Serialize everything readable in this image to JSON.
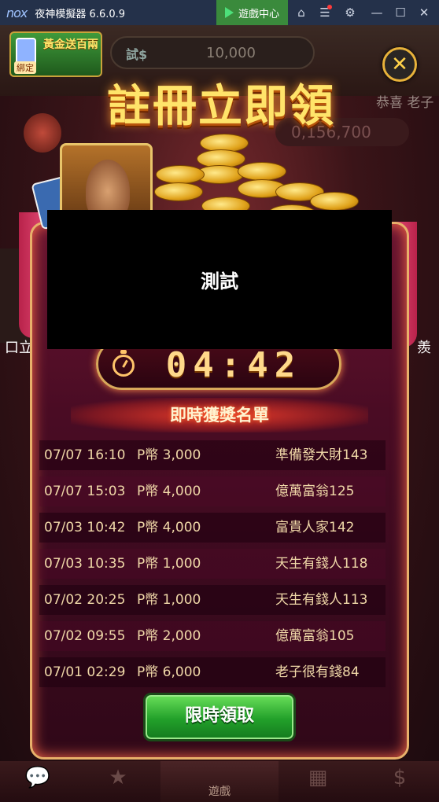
{
  "window": {
    "logo": "nox",
    "title": "夜神模擬器 6.6.0.9",
    "game_center": "遊戲中心",
    "icons": [
      "home-icon",
      "menu-icon",
      "settings-icon",
      "minimize-icon",
      "maximize-icon",
      "close-icon"
    ]
  },
  "background": {
    "bind_badge_label": "綁定",
    "bind_badge_text": "黃金送百兩",
    "trial_label": "試$",
    "trial_value": "10,000",
    "congrats_text": "恭喜 老子",
    "jackpot_value": "0,156,700",
    "side_left_text": "口立",
    "side_right_text": "羨"
  },
  "popup": {
    "banner_title": "註冊立即領",
    "timer": "04:42",
    "list_title": "即時獲獎名單",
    "winners": [
      {
        "time": "07/07 16:10",
        "prize": "P幣 3,000",
        "name": "準備發大財143"
      },
      {
        "time": "07/07 15:03",
        "prize": "P幣 4,000",
        "name": "億萬富翁125"
      },
      {
        "time": "07/03 10:42",
        "prize": "P幣 4,000",
        "name": "富貴人家142"
      },
      {
        "time": "07/03 10:35",
        "prize": "P幣 1,000",
        "name": "天生有錢人118"
      },
      {
        "time": "07/02 20:25",
        "prize": "P幣 1,000",
        "name": "天生有錢人113"
      },
      {
        "time": "07/02 09:55",
        "prize": "P幣 2,000",
        "name": "億萬富翁105"
      },
      {
        "time": "07/01 02:29",
        "prize": "P幣 6,000",
        "name": "老子很有錢84"
      }
    ],
    "claim_button": "限時領取",
    "close_symbol": "✕"
  },
  "toast": {
    "text": "測試"
  },
  "bottom_nav": {
    "center_label": "遊戲",
    "icons": [
      "chat-icon",
      "rank-icon",
      "games-icon",
      "calendar-icon",
      "shop-icon"
    ]
  },
  "colors": {
    "titlebar": "#24314a",
    "game_center": "#3a8a3c",
    "panel_border": "#e8b06a",
    "claim_green": "#22a02a",
    "gold_text": "#ffe46a"
  }
}
